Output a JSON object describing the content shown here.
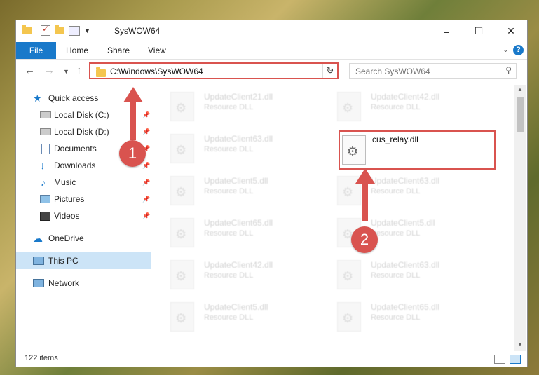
{
  "window": {
    "title": "SysWOW64"
  },
  "ribbon": {
    "tabs": [
      "File",
      "Home",
      "Share",
      "View"
    ],
    "help_icon": "help-icon"
  },
  "nav": {
    "address": "C:\\Windows\\SysWOW64",
    "search_placeholder": "Search SysWOW64"
  },
  "sidebar": {
    "items": [
      {
        "label": "Quick access",
        "icon": "star-icon"
      },
      {
        "label": "Local Disk (C:)",
        "icon": "drive-icon"
      },
      {
        "label": "Local Disk (D:)",
        "icon": "drive-icon"
      },
      {
        "label": "Documents",
        "icon": "documents-icon"
      },
      {
        "label": "Downloads",
        "icon": "download-icon"
      },
      {
        "label": "Music",
        "icon": "music-icon"
      },
      {
        "label": "Pictures",
        "icon": "pictures-icon"
      },
      {
        "label": "Videos",
        "icon": "videos-icon"
      },
      {
        "label": "OneDrive",
        "icon": "cloud-icon"
      },
      {
        "label": "This PC",
        "icon": "computer-icon"
      },
      {
        "label": "Network",
        "icon": "network-icon"
      }
    ]
  },
  "files": [
    {
      "name": "UpdateClient21.dll",
      "type": "Resource DLL"
    },
    {
      "name": "UpdateClient42.dll",
      "type": "Resource DLL"
    },
    {
      "name": "UpdateClient63.dll",
      "type": "Resource DLL"
    },
    {
      "name": "cus_relay.dll",
      "type": ""
    },
    {
      "name": "UpdateClient5.dll",
      "type": "Resource DLL"
    },
    {
      "name": "UpdateClient63.dll",
      "type": "Resource DLL"
    },
    {
      "name": "UpdateClient65.dll",
      "type": "Resource DLL"
    },
    {
      "name": "UpdateClient5.dll",
      "type": "Resource DLL"
    },
    {
      "name": "UpdateClient42.dll",
      "type": "Resource DLL"
    },
    {
      "name": "UpdateClient63.dll",
      "type": "Resource DLL"
    },
    {
      "name": "UpdateClient5.dll",
      "type": "Resource DLL"
    },
    {
      "name": "UpdateClient65.dll",
      "type": "Resource DLL"
    }
  ],
  "status": {
    "items_count": "122 items"
  },
  "annotations": {
    "step1": "1",
    "step2": "2"
  },
  "colors": {
    "accent": "#1979ca",
    "highlight": "#d9534f",
    "selected": "#cce4f7"
  }
}
